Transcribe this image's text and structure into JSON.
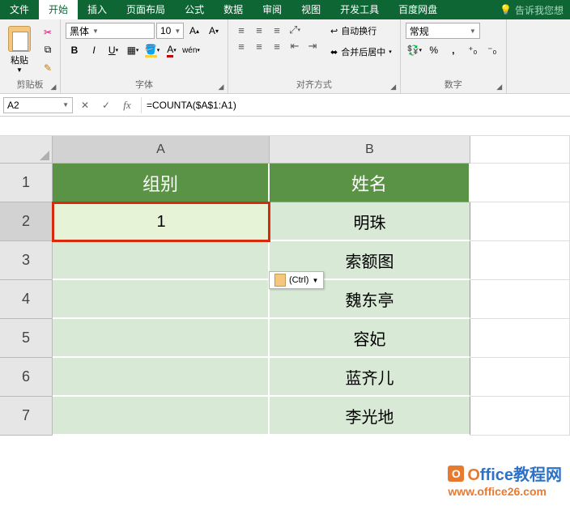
{
  "tabs": {
    "file": "文件",
    "home": "开始",
    "insert": "插入",
    "layout": "页面布局",
    "formula": "公式",
    "data": "数据",
    "review": "审阅",
    "view": "视图",
    "dev": "开发工具",
    "baidu": "百度网盘",
    "tellme": "告诉我您想"
  },
  "clipboard": {
    "paste": "粘贴",
    "label": "剪贴板"
  },
  "font": {
    "name": "黑体",
    "size": "10",
    "label": "字体"
  },
  "alignment": {
    "wrap": "自动换行",
    "merge": "合并后居中",
    "label": "对齐方式"
  },
  "number": {
    "format": "常规",
    "label": "数字"
  },
  "namebox": "A2",
  "formula": "=COUNTA($A$1:A1)",
  "paste_hint": "(Ctrl)",
  "headers": {
    "colA": "A",
    "colB": "B"
  },
  "rows": [
    "1",
    "2",
    "3",
    "4",
    "5",
    "6",
    "7"
  ],
  "table": {
    "hA": "组别",
    "hB": "姓名",
    "a2": "1",
    "b2": "明珠",
    "b3": "索额图",
    "b4": "魏东亭",
    "b5": "容妃",
    "b6": "蓝齐儿",
    "b7": "李光地"
  },
  "watermark": {
    "title_pre": "O",
    "title_rest": "ffice教程网",
    "url": "www.office26.com"
  }
}
